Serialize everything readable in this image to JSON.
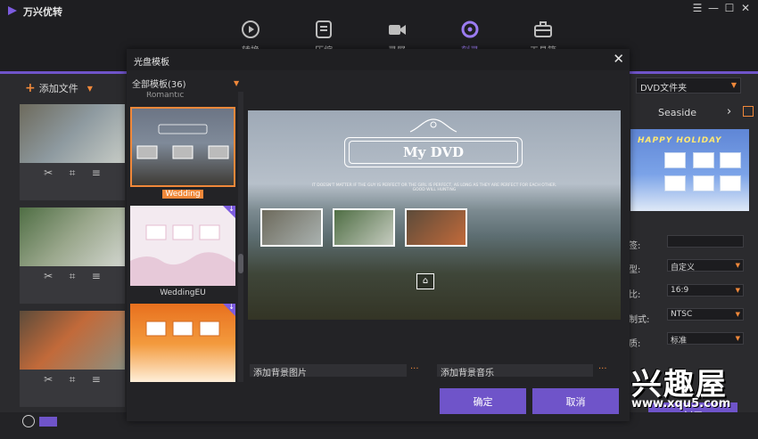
{
  "app": {
    "title": "万兴优转",
    "window_buttons": [
      "☰",
      "—",
      "☐",
      "✕"
    ]
  },
  "nav": [
    {
      "label": "转换",
      "icon": "convert-icon"
    },
    {
      "label": "压缩",
      "icon": "compress-icon"
    },
    {
      "label": "录屏",
      "icon": "record-icon"
    },
    {
      "label": "刻录",
      "icon": "burn-icon",
      "active": true
    },
    {
      "label": "工具箱",
      "icon": "toolbox-icon"
    }
  ],
  "left_panel": {
    "add_file_label": "添加文件"
  },
  "right_panel": {
    "output_target": "DVD文件夹",
    "theme_name": "Seaside",
    "theme_thumb_title": "HAPPY HOLIDAY",
    "settings": [
      {
        "label": "签:",
        "value": ""
      },
      {
        "label": "型:",
        "value": "自定义"
      },
      {
        "label": "比:",
        "value": "16:9"
      },
      {
        "label": "制式:",
        "value": "NTSC"
      },
      {
        "label": "质:",
        "value": "标准"
      }
    ],
    "burn_label": "刻录"
  },
  "modal": {
    "title": "光盘模板",
    "close": "✕",
    "filter_label": "全部模板(36)",
    "partial_label": "Romantic",
    "templates": [
      {
        "name": "Wedding",
        "selected": true
      },
      {
        "name": "WeddingEU",
        "download": true
      },
      {
        "name": "",
        "download": true
      }
    ],
    "preview": {
      "title": "My DVD",
      "subtitle": "IT DOESN'T MATTER IF THE GUY IS PERFECT OR THE GIRL IS PERFECT, AS LONG AS THEY ARE PERFECT FOR EACH OTHER.",
      "subtitle2": "GOOD WILL HUNTING"
    },
    "bg_image_label": "添加背景图片",
    "bg_music_label": "添加背景音乐",
    "dots": "···",
    "ok_label": "确定",
    "cancel_label": "取消"
  },
  "watermark": {
    "text": "兴趣屋",
    "url": "www.xqu5.com"
  },
  "colors": {
    "accent": "#6f54c9",
    "orange": "#f0883a",
    "background": "#2b2b2e"
  }
}
